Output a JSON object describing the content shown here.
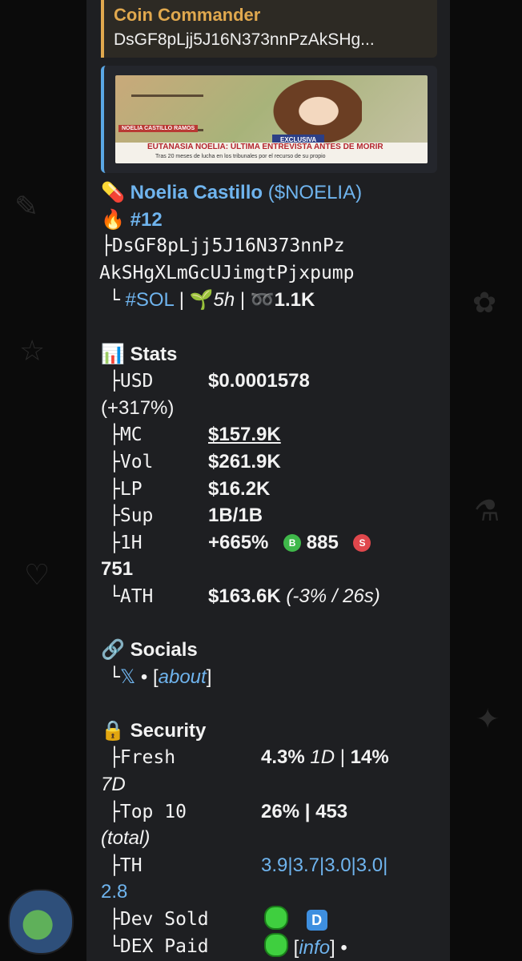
{
  "reply": {
    "title": "Coin Commander",
    "text": "DsGF8pLjj5J16N373nnPzAkSHg..."
  },
  "preview": {
    "tag": "NOELIA CASTILLO RAMOS",
    "badge": "EXCLUSIVA",
    "headline": "EUTANASIA NOELIA: ÚLTIMA ENTREVISTA ANTES DE MORIR",
    "subline": "Tras 20 meses de lucha en los tribunales por el recurso de su propio"
  },
  "token": {
    "name_icon": "pill",
    "name": "Noelia Castillo",
    "symbol": "$NOELIA",
    "rank_icon": "fire",
    "rank": "#12",
    "address_line1": "DsGF8pLjj5J16N373nnPz",
    "address_line2": "AkSHgXLmGcUJimgtPjxpump",
    "chain": "#SOL",
    "sep": "|",
    "age_icon": "seedling",
    "age": "5h",
    "holders_icon": "pretzel",
    "holders": "1.1K"
  },
  "stats": {
    "icon": "bar-chart",
    "title": "Stats",
    "usd_label": "USD",
    "usd_value": "$0.0001578",
    "usd_change": "(+317%)",
    "mc_label": "MC",
    "mc_value": "$157.9K",
    "vol_label": "Vol",
    "vol_value": "$261.9K",
    "lp_label": "LP",
    "lp_value": "$16.2K",
    "sup_label": "Sup",
    "sup_value": "1B/1B",
    "h1_label": "1H",
    "h1_value": "+665%",
    "buy_icon": "B",
    "buys": "885",
    "sell_icon": "S",
    "sells": "751",
    "ath_label": "ATH",
    "ath_value": "$163.6K",
    "ath_note": "(-3% / 26s)"
  },
  "socials": {
    "icon": "link",
    "title": "Socials",
    "x_link": "𝕏",
    "sep": "•",
    "about_open": "[",
    "about": "about",
    "about_close": "]"
  },
  "security": {
    "icon": "lock",
    "title": "Security",
    "fresh_label": "Fresh",
    "fresh_1d": "4.3%",
    "fresh_1d_unit": "1D",
    "fresh_7d": "14%",
    "fresh_7d_unit": "7D",
    "top10_label": "Top 10",
    "top10_pct": "26%",
    "top10_total": "453",
    "top10_note": "(total)",
    "th_label": "TH",
    "th_values_line1": "3.9|3.7|3.0|3.0|",
    "th_values_line2": "2.8",
    "dev_sold_label": "Dev Sold",
    "dev_badge": "D",
    "dex_paid_label": "DEX Paid",
    "info_open": "[",
    "info": "info",
    "info_close": "]",
    "trail": "•"
  },
  "tree": {
    "branch": "├",
    "end": "└"
  },
  "colors": {
    "accent_orange": "#e0a84e",
    "link_blue": "#6fb4ee",
    "buy_green": "#3fb84a",
    "sell_red": "#e0474c"
  }
}
